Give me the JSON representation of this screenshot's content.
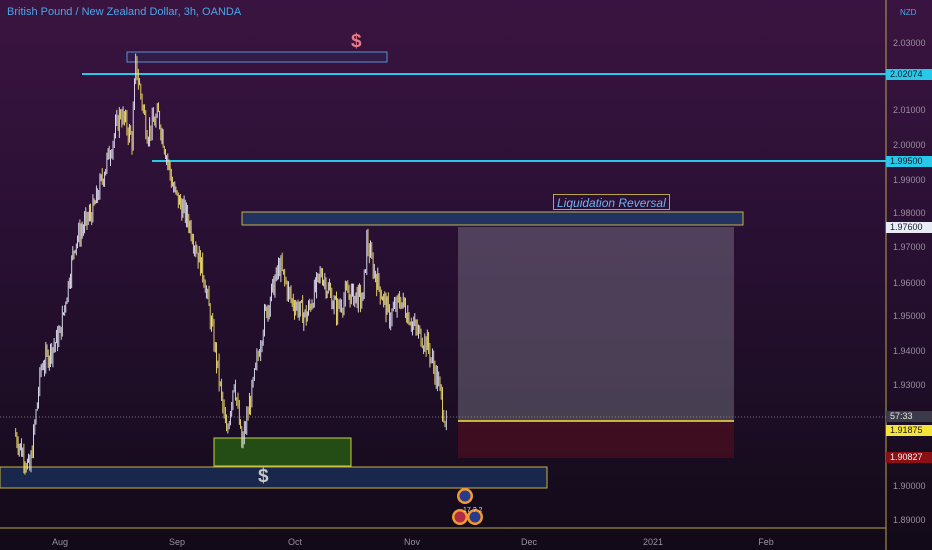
{
  "header": {
    "symbol_title": "British Pound / New Zealand Dollar, 3h, OANDA",
    "currency": "NZD"
  },
  "axis": {
    "y_ticks": [
      "2.03000",
      "2.01000",
      "2.00000",
      "1.99000",
      "1.98000",
      "1.97000",
      "1.96000",
      "1.95000",
      "1.94000",
      "1.93000",
      "1.90000",
      "1.89000"
    ],
    "x_ticks": [
      "Aug",
      "Sep",
      "Oct",
      "Nov",
      "Dec",
      "2021",
      "Feb"
    ]
  },
  "price_tags": {
    "resistance_high": "2.02074",
    "resistance_mid": "1.99500",
    "target": "1.97600",
    "countdown": "57:33",
    "current": "1.91875",
    "stop": "1.90827"
  },
  "annotations": {
    "reversal_label": "Liquidation Reversal",
    "dollar_top": "$",
    "dollar_bottom": "$"
  },
  "events": {
    "label": "17 ? 2"
  },
  "colors": {
    "resistance_line": "#28c8e8",
    "tag_current": "#f5e33a",
    "tag_stop": "#8b1016",
    "tag_target": "#e8ecf5",
    "candle_up": "#e8e8ff",
    "candle_down": "#f5e36a"
  },
  "chart_data": {
    "type": "candlestick",
    "symbol": "GBPNZD",
    "timeframe": "3h",
    "y_range": [
      1.888,
      2.043
    ],
    "path_points": [
      {
        "date": "Jul 20",
        "price": 1.916
      },
      {
        "date": "Jul 24",
        "price": 1.905
      },
      {
        "date": "Jul 27",
        "price": 1.935
      },
      {
        "date": "Aug 1",
        "price": 1.945
      },
      {
        "date": "Aug 5",
        "price": 1.972
      },
      {
        "date": "Aug 10",
        "price": 1.982
      },
      {
        "date": "Aug 14",
        "price": 1.998
      },
      {
        "date": "Aug 17",
        "price": 2.01
      },
      {
        "date": "Aug 20",
        "price": 2.002
      },
      {
        "date": "Aug 21",
        "price": 2.024
      },
      {
        "date": "Aug 24",
        "price": 2.004
      },
      {
        "date": "Aug 27",
        "price": 2.009
      },
      {
        "date": "Aug 31",
        "price": 1.987
      },
      {
        "date": "Sep 4",
        "price": 1.978
      },
      {
        "date": "Sep 8",
        "price": 1.962
      },
      {
        "date": "Sep 11",
        "price": 1.94
      },
      {
        "date": "Sep 14",
        "price": 1.915
      },
      {
        "date": "Sep 16",
        "price": 1.932
      },
      {
        "date": "Sep 18",
        "price": 1.912
      },
      {
        "date": "Sep 21",
        "price": 1.93
      },
      {
        "date": "Sep 24",
        "price": 1.95
      },
      {
        "date": "Sep 28",
        "price": 1.965
      },
      {
        "date": "Oct 1",
        "price": 1.955
      },
      {
        "date": "Oct 5",
        "price": 1.95
      },
      {
        "date": "Oct 9",
        "price": 1.963
      },
      {
        "date": "Oct 13",
        "price": 1.952
      },
      {
        "date": "Oct 16",
        "price": 1.957
      },
      {
        "date": "Oct 20",
        "price": 1.955
      },
      {
        "date": "Oct 21",
        "price": 1.972
      },
      {
        "date": "Oct 23",
        "price": 1.963
      },
      {
        "date": "Oct 27",
        "price": 1.95
      },
      {
        "date": "Oct 30",
        "price": 1.955
      },
      {
        "date": "Nov 3",
        "price": 1.946
      },
      {
        "date": "Nov 6",
        "price": 1.942
      },
      {
        "date": "Nov 9",
        "price": 1.93
      },
      {
        "date": "Nov 11",
        "price": 1.918
      }
    ],
    "horizontal_levels": [
      2.02074,
      1.995
    ],
    "zones": [
      {
        "name": "Liquidation Reversal",
        "from": 1.9773,
        "to": 1.9798
      },
      {
        "name": "support-green",
        "from": 1.9055,
        "to": 1.9105
      },
      {
        "name": "support-blue",
        "from": 1.8997,
        "to": 1.9057
      }
    ],
    "position": {
      "entry": 1.91875,
      "target": 1.976,
      "stop": 1.90827
    }
  }
}
